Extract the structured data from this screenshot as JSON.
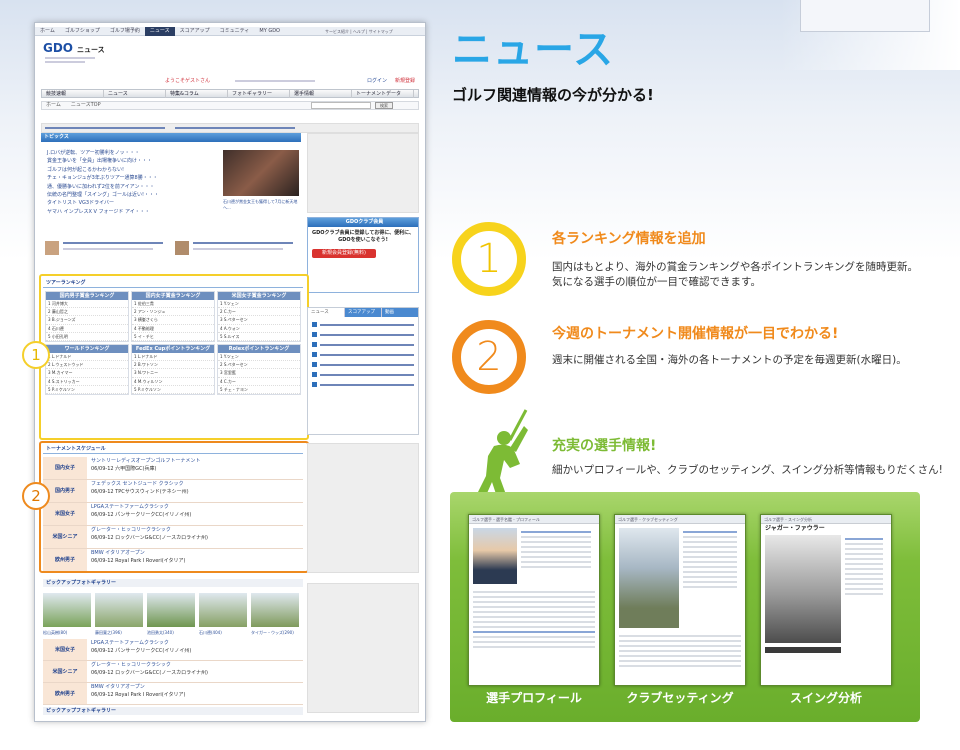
{
  "header": {
    "title": "ニュース",
    "subtitle": "ゴルフ関連情報の今が分かる!"
  },
  "features": [
    {
      "number": "1",
      "title": "各ランキング情報を追加",
      "desc_line1": "国内はもとより、海外の賞金ランキングや各ポイントランキングを随時更新。",
      "desc_line2": "気になる選手の順位が一目で確認できます。"
    },
    {
      "number": "2",
      "title": "今週のトーナメント開催情報が一目でわかる!",
      "desc_line1": "週末に開催される全国・海外の各トーナメントの予定を毎週更新(水曜日)。"
    },
    {
      "title": "充実の選手情報!",
      "desc_line1": "細かいプロフィールや、クラブのセッティング、スイング分析等情報もりだくさん!"
    }
  ],
  "thumbnails": [
    {
      "caption": "選手プロフィール",
      "header": "ゴルフ選手・選手名鑑 - プロフィール"
    },
    {
      "caption": "クラブセッティング",
      "header": "ゴルフ選手 - クラブセッティング"
    },
    {
      "caption": "スイング分析",
      "header": "ゴルフ選手 - スイング分析",
      "player": "ジャガー・ファウラー"
    }
  ],
  "site": {
    "topnav": [
      "ホーム",
      "ゴルフショップ",
      "ゴルフ場予約",
      "ニュース",
      "スコアアップ",
      "コミュニティ",
      "MY GDO"
    ],
    "topnav_active": "ニュース",
    "util_links": "サービス紹介 | ヘルプ | サイトマップ",
    "logo": "GDO",
    "logo_section": "ニュース",
    "welcome": "ようこそゲストさん",
    "login": "ログイン",
    "register": "新規登録",
    "nav": [
      "競技速報",
      "ニュース",
      "特集&コラム",
      "フォトギャラリー",
      "選手情報",
      "トーナメントデータ",
      "テレビ情報"
    ],
    "crumb": [
      "ホーム",
      "ニュースTOP"
    ],
    "search_button": "検索",
    "topics_header": "トピックス",
    "topics": [
      "J.ロバが逆転、ツアー初勝利をノッ・・・",
      "賞金王争いを「全員」出場権争いに向け・・・",
      "ゴルフは何が起こるかわからない!",
      "チェ・キョンジュが3年ぶりツアー通算8勝・・・",
      "通、優勝争いに加われず2位を前アイアン・・・",
      "伝統の名門整理「スイング」ゴールは近い!・・・",
      "タイトリスト VG3ドライバー",
      "ヤマハ インプレスX V フォージド アイ・・・"
    ],
    "photo_caption": "石川遼が賞金女王も獲得して7月に新天地へ...",
    "member_header": "GDOクラブ会員",
    "member_text": "GDOクラブ会員に登録してお得に、便利に、GDOを使いこなそう!",
    "member_button": "新規会員登録(無料)",
    "ranking_header": "ツアーランキング",
    "ranking_tables": [
      {
        "title": "国内男子賞金ランキング",
        "rows": [
          "1 河井博大",
          "2 藤山哲之",
          "3 B.ジョーンズ",
          "4 石川遼",
          "5 小田孔明"
        ]
      },
      {
        "title": "国内女子賞金ランキング",
        "rows": [
          "1 佐伯三貴",
          "2 アン・ソンジュ",
          "3 横峯さくら",
          "4 不動裕理",
          "5 イ・チヒ"
        ]
      },
      {
        "title": "米国女子賞金ランキング",
        "rows": [
          "1 Y.ツェン",
          "2 C.カー",
          "3 S.ペターセン",
          "4 A.ウォン",
          "5 S.ルイス"
        ]
      },
      {
        "title": "ワールドランキング",
        "rows": [
          "1 L.ドナルド",
          "2 L.ウェストウッド",
          "3 M.カイマー",
          "4 S.ストリッカー",
          "5 P.ミケルソン"
        ]
      },
      {
        "title": "FedEx Cupポイントランキング",
        "rows": [
          "1 L.ドナルド",
          "2 B.ワトソン",
          "3 N.ワトニー",
          "4 M.ウィルソン",
          "5 P.ミケルソン"
        ]
      },
      {
        "title": "Rolexポイントランキング",
        "rows": [
          "1 Y.ツェン",
          "2 S.ペターセン",
          "3 宮里藍",
          "4 C.カー",
          "5 チェ・ナヨン"
        ]
      }
    ],
    "news_tabs": [
      "ニュース",
      "スコアアップ",
      "動画"
    ],
    "schedule_header": "トーナメントスケジュール",
    "schedule": [
      {
        "label": "国内女子",
        "event": "サントリーレディスオープンゴルフトーナメント",
        "date": "06/09-12 六甲国際GC(兵庫)"
      },
      {
        "label": "国内男子",
        "event": "フェデックス セントジュード クラシック",
        "date": "06/09-12 TPCサウスウィンド(テネシー州)"
      },
      {
        "label": "米国女子",
        "event": "LPGAステートファームクラシック",
        "date": "06/09-12 パンサークリークCC(イリノイ州)"
      },
      {
        "label": "米国シニア",
        "event": "グレーター・ヒッコリークラシック",
        "date": "06/09-12 ロックバーンG&CC(ノースカロライナ州)"
      },
      {
        "label": "欧州男子",
        "event": "BMW イタリアオープン",
        "date": "06/09-12 Royal Park I Roveri(イタリア)"
      }
    ],
    "gallery_header": "ピックアップフォトギャラリー",
    "gallery_names": [
      "松山英樹(80)",
      "藤田寛之(396)",
      "池田勇太(340)",
      "石川遼(404)",
      "タイガー・ウッズ(290)"
    ],
    "gallery_footer": "ピックアップフォトギャラリー"
  }
}
